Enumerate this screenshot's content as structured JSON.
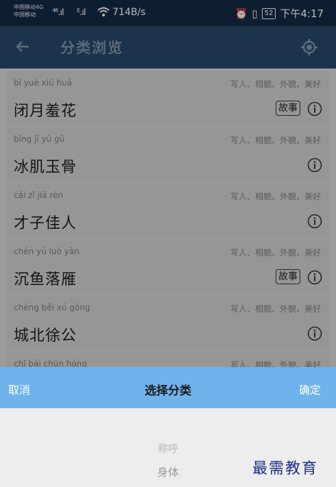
{
  "status_bar": {
    "carrier1": "中国移动4G",
    "carrier2": "中国移动",
    "net_speed": "714B/s",
    "battery": "52",
    "time": "下午4:17"
  },
  "header": {
    "title": "分类浏览",
    "back_icon": "arrow-left-icon",
    "locate_icon": "locate-icon"
  },
  "items": [
    {
      "pinyin": "bì yuè xiū huā",
      "tags": "写人、相貌、外貌、美好",
      "word": "闭月羞花",
      "badge": "故事"
    },
    {
      "pinyin": "bīng jī yù gǔ",
      "tags": "写人、相貌、外貌、美好",
      "word": "冰肌玉骨",
      "badge": ""
    },
    {
      "pinyin": "cái zǐ jiā rén",
      "tags": "写人、相貌、外貌、美好",
      "word": "才子佳人",
      "badge": ""
    },
    {
      "pinyin": "chén yú luò yàn",
      "tags": "写人、相貌、外貌、美好",
      "word": "沉鱼落雁",
      "badge": "故事"
    },
    {
      "pinyin": "chéng běi xú gōng",
      "tags": "写人、相貌、外貌、美好",
      "word": "城北徐公",
      "badge": ""
    },
    {
      "pinyin": "chǐ bái chún hóng",
      "tags": "写人、相貌、外貌、美好",
      "word": "",
      "badge": ""
    }
  ],
  "sheet": {
    "cancel": "取消",
    "title": "选择分类",
    "confirm": "确定",
    "options": [
      "称呼",
      "身体"
    ]
  },
  "watermark": "最需教育"
}
